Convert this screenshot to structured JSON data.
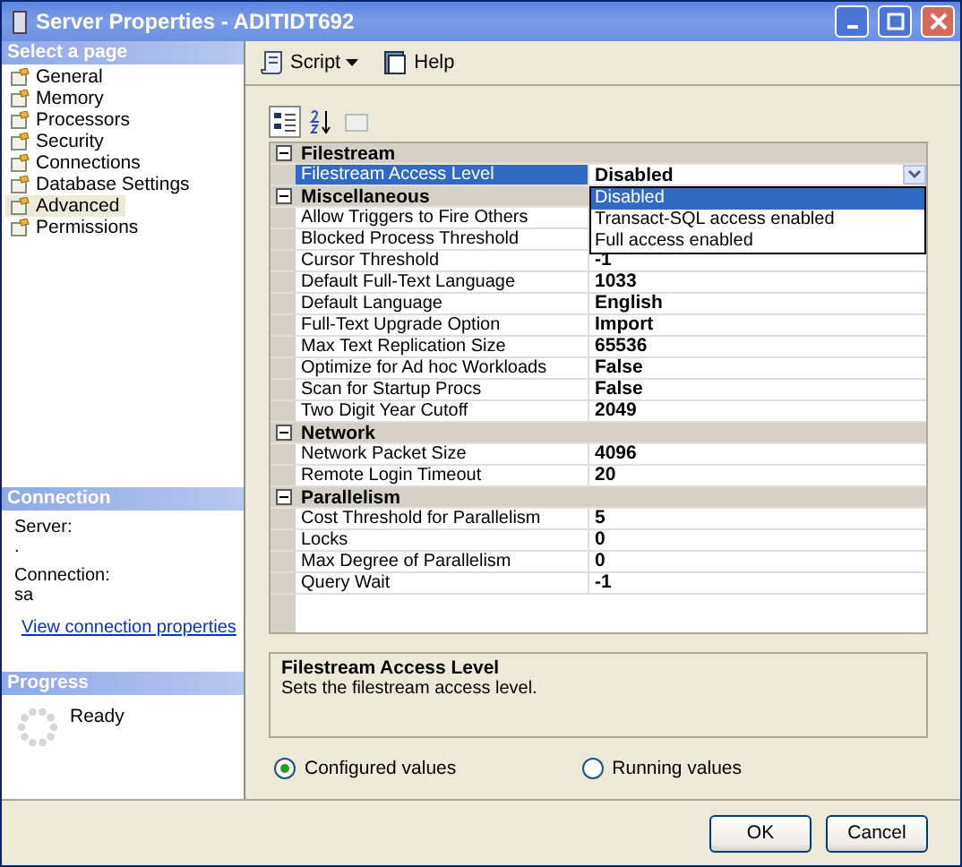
{
  "window": {
    "title": "Server Properties - ADITIDT692"
  },
  "sidebar": {
    "header": "Select a page",
    "items": [
      {
        "label": "General",
        "selected": false
      },
      {
        "label": "Memory",
        "selected": false
      },
      {
        "label": "Processors",
        "selected": false
      },
      {
        "label": "Security",
        "selected": false
      },
      {
        "label": "Connections",
        "selected": false
      },
      {
        "label": "Database Settings",
        "selected": false
      },
      {
        "label": "Advanced",
        "selected": true
      },
      {
        "label": "Permissions",
        "selected": false
      }
    ]
  },
  "connection": {
    "header": "Connection",
    "server_label": "Server:",
    "server_value": ".",
    "connection_label": "Connection:",
    "connection_value": "sa",
    "link": "View connection properties"
  },
  "progress": {
    "header": "Progress",
    "status": "Ready"
  },
  "toolbar": {
    "script": "Script",
    "help": "Help"
  },
  "property_grid": {
    "categories": [
      {
        "name": "Filestream",
        "expanded": true,
        "properties": [
          {
            "name": "Filestream Access Level",
            "value": "Disabled",
            "selected": true,
            "dropdown": [
              {
                "label": "Disabled",
                "selected": true
              },
              {
                "label": "Transact-SQL access enabled",
                "selected": false
              },
              {
                "label": "Full access enabled",
                "selected": false
              }
            ]
          }
        ]
      },
      {
        "name": "Miscellaneous",
        "expanded": true,
        "properties": [
          {
            "name": "Allow Triggers to Fire Others",
            "selected": false
          },
          {
            "name": "Blocked Process Threshold",
            "selected": false
          },
          {
            "name": "Cursor Threshold",
            "value": "-1",
            "selected": false
          },
          {
            "name": "Default Full-Text Language",
            "value": "1033",
            "selected": false
          },
          {
            "name": "Default Language",
            "value": "English",
            "selected": false
          },
          {
            "name": "Full-Text Upgrade Option",
            "value": "Import",
            "selected": false
          },
          {
            "name": "Max Text Replication Size",
            "value": "65536",
            "selected": false
          },
          {
            "name": "Optimize for Ad hoc Workloads",
            "value": "False",
            "selected": false
          },
          {
            "name": "Scan for Startup Procs",
            "value": "False",
            "selected": false
          },
          {
            "name": "Two Digit Year Cutoff",
            "value": "2049",
            "selected": false
          }
        ]
      },
      {
        "name": "Network",
        "expanded": true,
        "properties": [
          {
            "name": "Network Packet Size",
            "value": "4096",
            "selected": false
          },
          {
            "name": "Remote Login Timeout",
            "value": "20",
            "selected": false
          }
        ]
      },
      {
        "name": "Parallelism",
        "expanded": true,
        "properties": [
          {
            "name": "Cost Threshold for Parallelism",
            "value": "5",
            "selected": false
          },
          {
            "name": "Locks",
            "value": "0",
            "selected": false
          },
          {
            "name": "Max Degree of Parallelism",
            "value": "0",
            "selected": false
          },
          {
            "name": "Query Wait",
            "value": "-1",
            "selected": false
          }
        ]
      }
    ]
  },
  "description": {
    "title": "Filestream Access Level",
    "text": "Sets the filestream access level."
  },
  "value_mode": [
    {
      "label": "Configured values",
      "selected": true
    },
    {
      "label": "Running values",
      "selected": false
    }
  ],
  "buttons": [
    "OK",
    "Cancel"
  ]
}
